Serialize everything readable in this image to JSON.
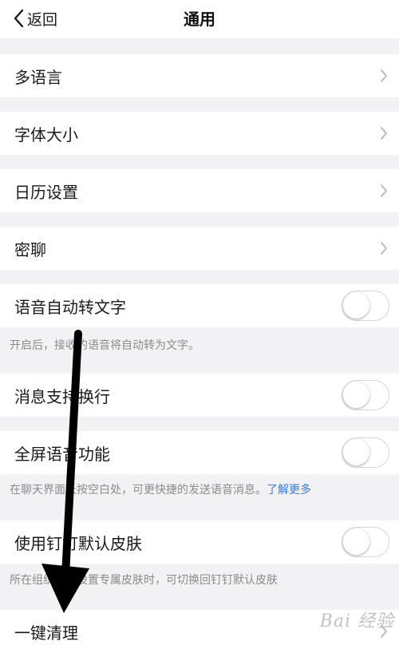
{
  "header": {
    "back_label": "返回",
    "title": "通用"
  },
  "items": {
    "language": "多语言",
    "font_size": "字体大小",
    "calendar": "日历设置",
    "secret_chat": "密聊",
    "voice_to_text": "语音自动转文字",
    "line_break": "消息支持换行",
    "fullscreen_voice": "全屏语音功能",
    "default_skin": "使用钉钉默认皮肤",
    "one_click_clean": "一键清理"
  },
  "notes": {
    "voice_to_text": "开启后，接收的语音将自动转为文字。",
    "fullscreen_voice": "在聊天界面长按空白处，可更快捷的发送语音消息。",
    "fullscreen_voice_link": "了解更多",
    "default_skin": "所在组织企业设置专属皮肤时，可切换回钉钉默认皮肤"
  },
  "toggles": {
    "voice_to_text": false,
    "line_break": false,
    "fullscreen_voice": false,
    "default_skin": false
  },
  "watermark": "Bai 经验",
  "colors": {
    "link": "#3a7bd5",
    "background": "#f2f2f4",
    "annotation_arrow": "#000000"
  },
  "icons": {
    "back": "chevron-left-icon",
    "row_arrow": "chevron-right-icon",
    "overlay": "down-arrow-annotation"
  }
}
